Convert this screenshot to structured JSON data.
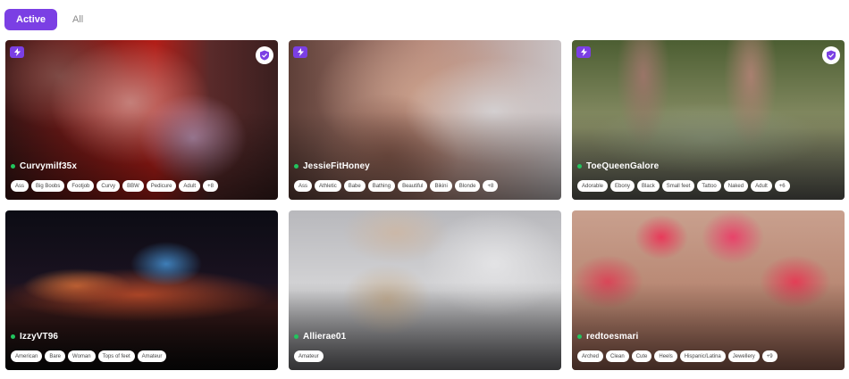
{
  "tabs": [
    {
      "label": "Active",
      "active": true
    },
    {
      "label": "All",
      "active": false
    }
  ],
  "icons": {
    "bolt": "lightning-icon",
    "shield": "verified-shield-icon"
  },
  "colors": {
    "accent": "#7b3fe4",
    "online": "#22c55e"
  },
  "cards": [
    {
      "name": "Curvymilf35x",
      "verified": true,
      "tags": [
        "Ass",
        "Big Boobs",
        "Footjob",
        "Curvy",
        "BBW",
        "Pedicure",
        "Adult"
      ],
      "more": "+8"
    },
    {
      "name": "JessieFitHoney",
      "verified": false,
      "tags": [
        "Ass",
        "Athletic",
        "Babe",
        "Bathing",
        "Beautiful",
        "Bikini",
        "Blonde"
      ],
      "more": "+8"
    },
    {
      "name": "ToeQueenGalore",
      "verified": true,
      "tags": [
        "Adorable",
        "Ebony",
        "Black",
        "Small feet",
        "Tattoo",
        "Naked",
        "Adult"
      ],
      "more": "+6"
    },
    {
      "name": "IzzyVT96",
      "verified": false,
      "tags": [
        "American",
        "Bare",
        "Woman",
        "Tops of feet",
        "Amateur"
      ],
      "more": ""
    },
    {
      "name": "Allierae01",
      "verified": false,
      "tags": [
        "Amateur"
      ],
      "more": ""
    },
    {
      "name": "redtoesmari",
      "verified": false,
      "tags": [
        "Arched",
        "Clean",
        "Cute",
        "Heels",
        "Hispanic/Latina",
        "Jewellery"
      ],
      "more": "+9"
    }
  ]
}
